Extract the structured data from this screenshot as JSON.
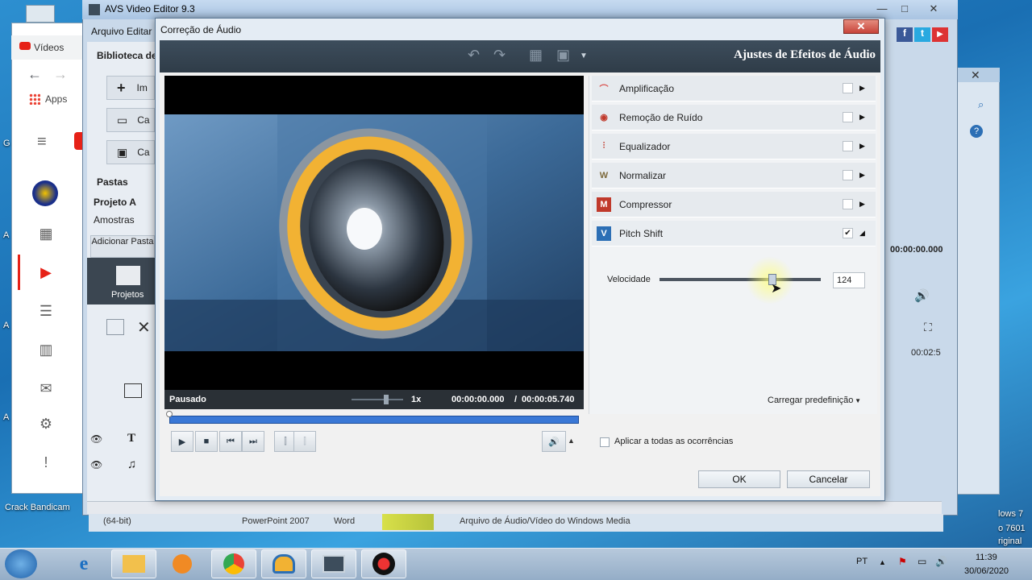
{
  "desktop": {
    "left_labels": [
      "G",
      "A",
      "A",
      "A"
    ],
    "bottom_left_label": "Crack Bandicam",
    "bottom_strip_labels": [
      "(64-bit)",
      "PowerPoint 2007",
      "Word"
    ],
    "taskbar_file_label": "Arquivo de Áudio/Vídeo do Windows Media",
    "windows_watermark": [
      "lows 7",
      "o 7601",
      "riginal"
    ]
  },
  "chrome": {
    "tab_label": "Vídeos",
    "apps_label": "Apps"
  },
  "avs": {
    "title": "AVS Video Editor 9.3",
    "menu": [
      "Arquivo",
      "Editar"
    ],
    "library_label": "Biblioteca de",
    "side_buttons": [
      "Im",
      "Ca",
      "Ca"
    ],
    "folders_label": "Pastas",
    "folder_items": [
      "Projeto A",
      "Amostras"
    ],
    "add_folder_label": "Adicionar Pasta",
    "projects_label": "Projetos",
    "time_readout": "00:00:00.000",
    "timeline_time": "00:02:5"
  },
  "dialog": {
    "title": "Correção de Áudio",
    "heading": "Ajustes de Efeitos de Áudio",
    "close_symbol": "✕",
    "player": {
      "status": "Pausado",
      "speed": "1x",
      "current_time": "00:00:00.000",
      "separator": "/",
      "total_time": "00:00:05.740"
    },
    "effects": [
      {
        "label": "Amplificação",
        "icon": "amplify-icon",
        "checked": false,
        "expanded": false,
        "glyph": "⌒",
        "color": "#d9534f"
      },
      {
        "label": "Remoção de Ruído",
        "icon": "noise-removal-icon",
        "checked": false,
        "expanded": false,
        "glyph": "◉",
        "color": "#c0392b"
      },
      {
        "label": "Equalizador",
        "icon": "equalizer-icon",
        "checked": false,
        "expanded": false,
        "glyph": "⫶",
        "color": "#c0392b"
      },
      {
        "label": "Normalizar",
        "icon": "normalize-icon",
        "checked": false,
        "expanded": false,
        "glyph": "W",
        "color": "#7d6a3c"
      },
      {
        "label": "Compressor",
        "icon": "compressor-icon",
        "checked": false,
        "expanded": false,
        "glyph": "M",
        "color": "#c0392b"
      },
      {
        "label": "Pitch Shift",
        "icon": "pitch-shift-icon",
        "checked": true,
        "expanded": true,
        "glyph": "V",
        "color": "#2c6fb5"
      }
    ],
    "pitch": {
      "param_label": "Velocidade",
      "value": "124",
      "slider_fraction": 0.7
    },
    "preset_label": "Carregar predefinição",
    "apply_all_label": "Aplicar a todas as ocorrências",
    "ok_label": "OK",
    "cancel_label": "Cancelar"
  },
  "tray": {
    "language": "PT",
    "time": "11:39",
    "date": "30/06/2020"
  }
}
